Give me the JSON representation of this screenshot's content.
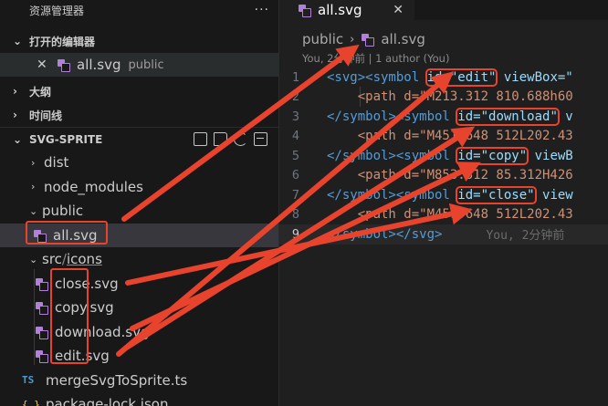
{
  "explorer": {
    "title": "资源管理器",
    "more": "···",
    "sections": {
      "open_editors": "打开的编辑器",
      "outline": "大纲",
      "timeline": "时间线",
      "project": "SVG-SPRITE"
    },
    "open_editor": {
      "close": "✕",
      "name": "all.svg",
      "folder": "public"
    },
    "tree": {
      "dist": "dist",
      "node_modules": "node_modules",
      "public": "public",
      "all_svg": "all.svg",
      "src": "src",
      "slash": "/",
      "icons": "icons",
      "close_svg": "close.svg",
      "copy_svg": "copy.svg",
      "download_svg": "download.svg",
      "edit_svg": "edit.svg",
      "merge_ts": "mergeSvgToSprite.ts",
      "package_lock": "package-lock.json",
      "ts_badge": "TS",
      "json_badge": "{ }"
    }
  },
  "editor": {
    "tab": {
      "label": "all.svg",
      "close": "✕"
    },
    "breadcrumb": {
      "folder": "public",
      "sep": "›",
      "file": "all.svg"
    },
    "blame": "You, 2分钟前 | 1 author (You)",
    "inline_blame": "You, 2分钟前",
    "lines": [
      {
        "n": "1",
        "p1": "<svg><symbol ",
        "attr": "id=\"edit\"",
        "p2": " viewBox=\""
      },
      {
        "n": "2",
        "p1": "    <path d=\"M213.312 810.688h60",
        "attr": "",
        "p2": ""
      },
      {
        "n": "3",
        "p1": "</symbol><symbol ",
        "attr": "id=\"download\"",
        "p2": " v"
      },
      {
        "n": "4",
        "p1": "    <path d=\"M451.648 512L202.43",
        "attr": "",
        "p2": ""
      },
      {
        "n": "5",
        "p1": "</symbol><symbol ",
        "attr": "id=\"copy\"",
        "p2": " viewB"
      },
      {
        "n": "6",
        "p1": "    <path d=\"M853.312 85.312H426",
        "attr": "",
        "p2": ""
      },
      {
        "n": "7",
        "p1": "</symbol><symbol ",
        "attr": "id=\"close\"",
        "p2": " view"
      },
      {
        "n": "8",
        "p1": "    <path d=\"M451.648 512L202.43",
        "attr": "",
        "p2": ""
      },
      {
        "n": "9",
        "p1": "</symbol></svg>",
        "attr": "",
        "p2": ""
      }
    ]
  },
  "colors": {
    "annotation": "#e8432d",
    "svg_icon": "#b180d7",
    "ts_icon": "#4a9cd6"
  }
}
